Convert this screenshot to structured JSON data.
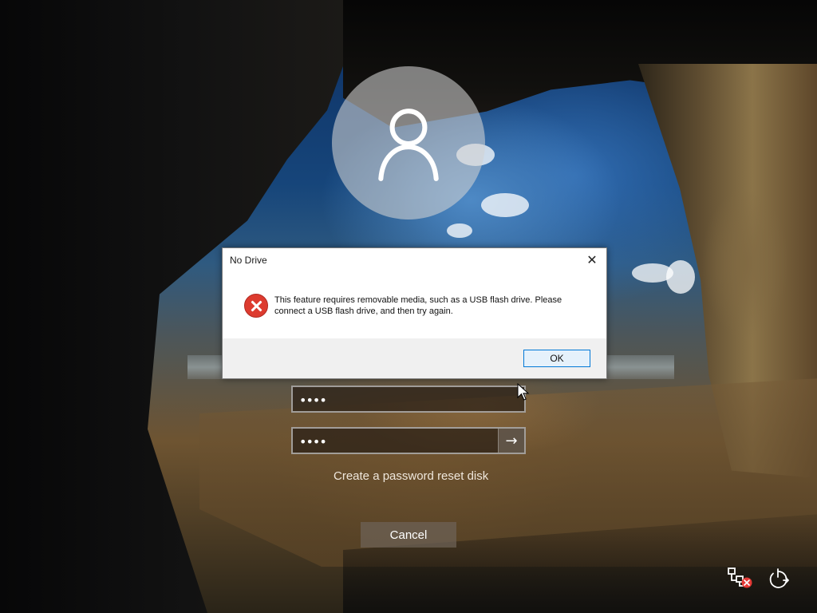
{
  "background": {
    "description_colors": {
      "sky": "#1b5d9f",
      "rock": "#15120f",
      "sand": "#7a5a35"
    }
  },
  "user_avatar": {
    "icon": "user-icon"
  },
  "dialog": {
    "title": "No Drive",
    "message": "This feature requires removable media, such as a USB flash drive. Please connect a USB flash drive, and then try again.",
    "ok_label": "OK",
    "close_symbol": "✕",
    "icon": "error-icon"
  },
  "login": {
    "password_value_1": "••••",
    "password_value_2": "••••",
    "submit_icon": "arrow-right-icon",
    "reset_link": "Create a password reset disk",
    "cancel_label": "Cancel"
  },
  "tray": {
    "network_icon": "network-disconnected-icon",
    "power_icon": "power-options-icon"
  }
}
